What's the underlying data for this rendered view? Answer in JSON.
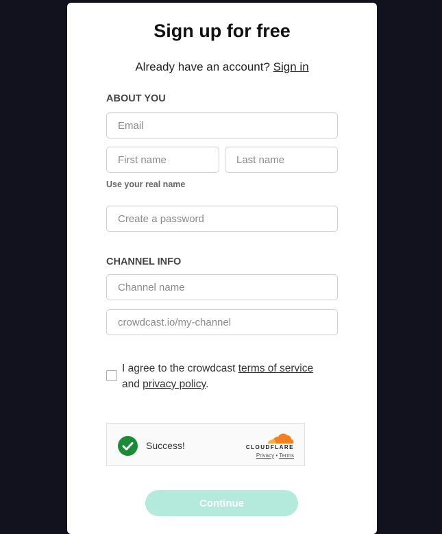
{
  "header": {
    "title": "Sign up for free",
    "prompt": "Already have an account?",
    "sign_in_link": "Sign in"
  },
  "about_you": {
    "heading": "ABOUT YOU",
    "email_placeholder": "Email",
    "first_name_placeholder": "First name",
    "last_name_placeholder": "Last name",
    "name_hint": "Use your real name",
    "password_placeholder": "Create a password"
  },
  "channel_info": {
    "heading": "CHANNEL INFO",
    "channel_name_placeholder": "Channel name",
    "channel_url_placeholder": "crowdcast.io/my-channel"
  },
  "agreement": {
    "checked": false,
    "text_before": "I agree to the crowdcast ",
    "terms_link": "terms of service",
    "text_and": " and ",
    "privacy_link": "privacy policy",
    "text_end": "."
  },
  "captcha": {
    "status": "Success!",
    "provider": "CLOUDFLARE",
    "privacy_link": "Privacy",
    "separator": "•",
    "terms_link": "Terms",
    "success_color": "#1b8b38",
    "brand_color": "#f38020"
  },
  "actions": {
    "continue_label": "Continue",
    "continue_color": "#b3eadb"
  }
}
